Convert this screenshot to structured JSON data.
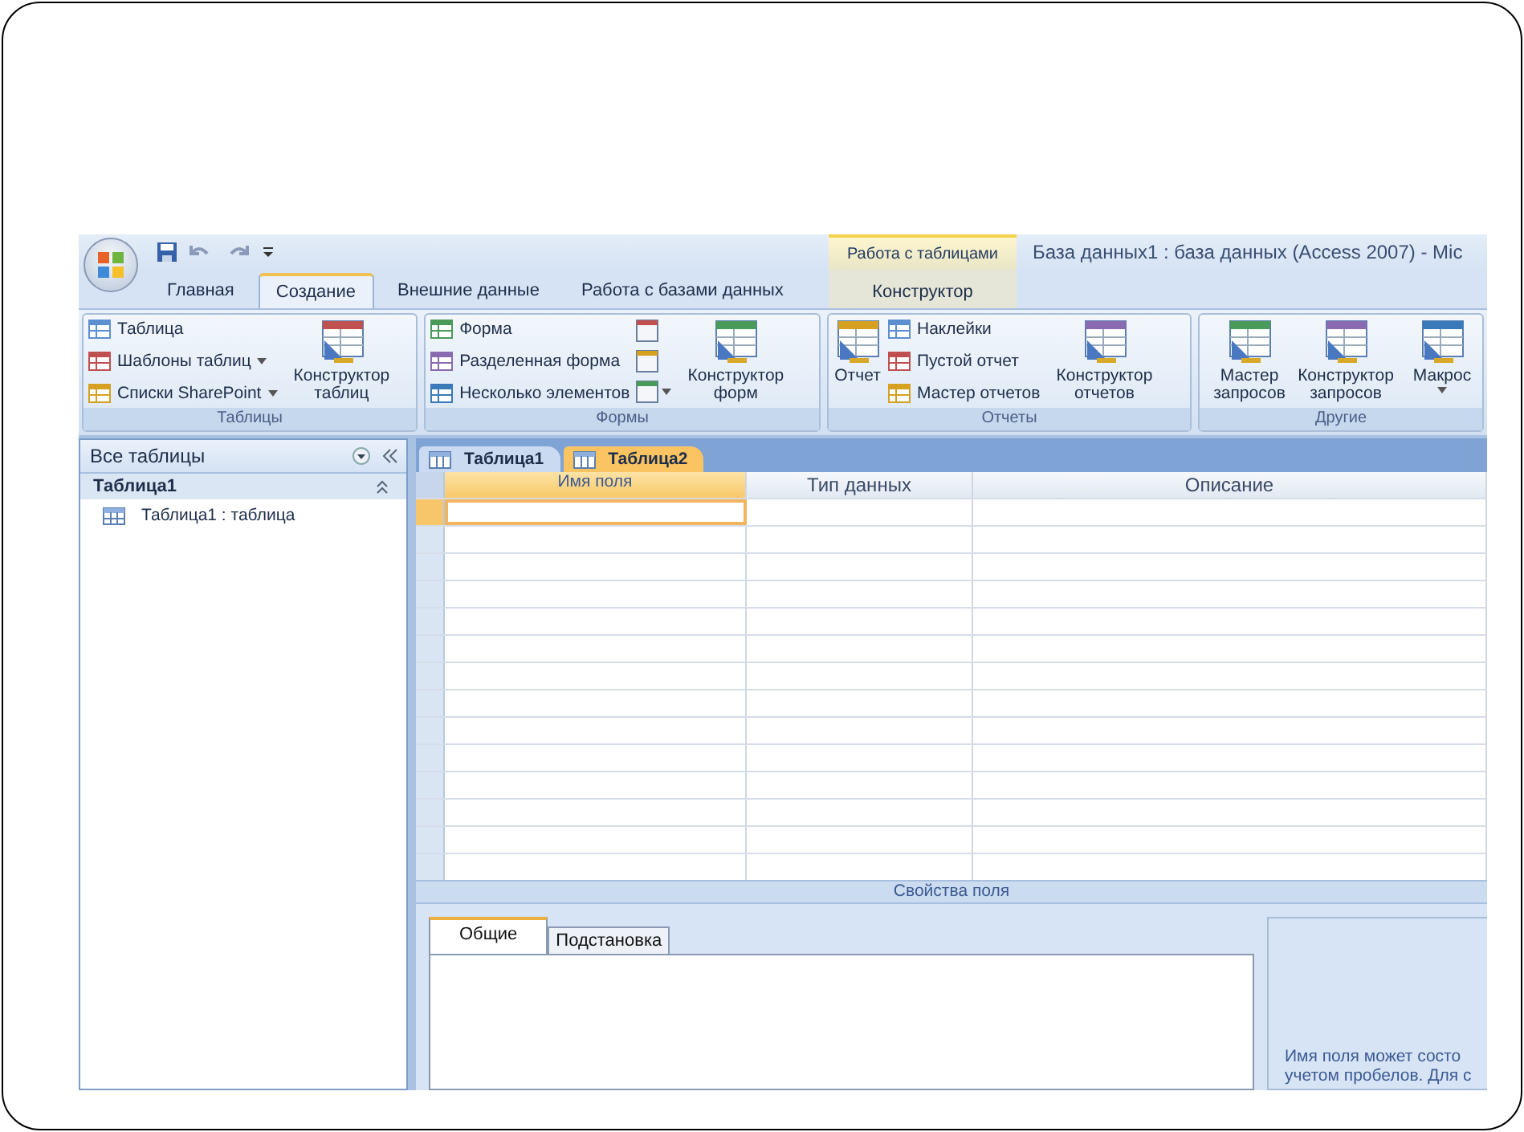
{
  "window": {
    "title": "База данных1 : база данных (Access 2007) - Mic",
    "context_group": "Работа с таблицами"
  },
  "tabs": [
    {
      "label": "Главная",
      "selected": false,
      "kind": "main"
    },
    {
      "label": "Создание",
      "selected": true,
      "kind": "main"
    },
    {
      "label": "Внешние данные",
      "selected": false,
      "kind": "main"
    },
    {
      "label": "Работа с базами данных",
      "selected": false,
      "kind": "main"
    },
    {
      "label": "Конструктор",
      "selected": false,
      "kind": "context"
    }
  ],
  "ribbon": {
    "groups": [
      {
        "title": "Таблицы",
        "columns": [
          {
            "kind": "stack",
            "items": [
              {
                "label": "Таблица",
                "dropdown": false
              },
              {
                "label": "Шаблоны таблиц",
                "dropdown": true
              },
              {
                "label": "Списки SharePoint",
                "dropdown": true
              }
            ]
          },
          {
            "kind": "large",
            "items": [
              {
                "label": "Конструктор таблиц",
                "dropdown": false
              }
            ]
          }
        ]
      },
      {
        "title": "Формы",
        "columns": [
          {
            "kind": "stack",
            "items": [
              {
                "label": "Форма",
                "dropdown": false
              },
              {
                "label": "Разделенная форма",
                "dropdown": false
              },
              {
                "label": "Несколько элементов",
                "dropdown": false
              }
            ]
          },
          {
            "kind": "icons",
            "items": [
              {
                "dropdown": false
              },
              {
                "dropdown": false
              },
              {
                "dropdown": true
              }
            ]
          },
          {
            "kind": "large",
            "items": [
              {
                "label": "Конструктор форм",
                "dropdown": false
              }
            ]
          }
        ]
      },
      {
        "title": "Отчеты",
        "columns": [
          {
            "kind": "large",
            "items": [
              {
                "label": "Отчет",
                "dropdown": false
              }
            ]
          },
          {
            "kind": "stack",
            "items": [
              {
                "label": "Наклейки",
                "dropdown": false
              },
              {
                "label": "Пустой отчет",
                "dropdown": false
              },
              {
                "label": "Мастер отчетов",
                "dropdown": false
              }
            ]
          },
          {
            "kind": "large",
            "items": [
              {
                "label": "Конструктор отчетов",
                "dropdown": false
              }
            ]
          }
        ]
      },
      {
        "title": "Другие",
        "columns": [
          {
            "kind": "large",
            "items": [
              {
                "label": "Мастер запросов",
                "dropdown": false
              }
            ]
          },
          {
            "kind": "large",
            "items": [
              {
                "label": "Конструктор запросов",
                "dropdown": false
              }
            ]
          },
          {
            "kind": "large",
            "items": [
              {
                "label": "Макрос",
                "dropdown": true
              }
            ]
          }
        ]
      }
    ]
  },
  "navigation": {
    "header": "Все таблицы",
    "groups": [
      {
        "title": "Таблица1",
        "expanded": true,
        "items": [
          "Таблица1 : таблица"
        ]
      }
    ]
  },
  "documents": [
    {
      "label": "Таблица1",
      "selected": false
    },
    {
      "label": "Таблица2",
      "selected": true
    }
  ],
  "design_grid": {
    "columns": [
      "Имя поля",
      "Тип данных",
      "Описание"
    ],
    "rows": [
      {
        "selected": true
      },
      {
        "selected": false
      },
      {
        "selected": false
      },
      {
        "selected": false
      },
      {
        "selected": false
      },
      {
        "selected": false
      },
      {
        "selected": false
      },
      {
        "selected": false
      },
      {
        "selected": false
      },
      {
        "selected": false
      },
      {
        "selected": false
      },
      {
        "selected": false
      },
      {
        "selected": false
      },
      {
        "selected": false
      }
    ]
  },
  "field_properties": {
    "title": "Свойства поля",
    "tabs": [
      {
        "label": "Общие",
        "selected": true
      },
      {
        "label": "Подстановка",
        "selected": false
      }
    ],
    "help_lines": [
      "Имя поля может состо",
      "учетом пробелов. Для с"
    ]
  }
}
